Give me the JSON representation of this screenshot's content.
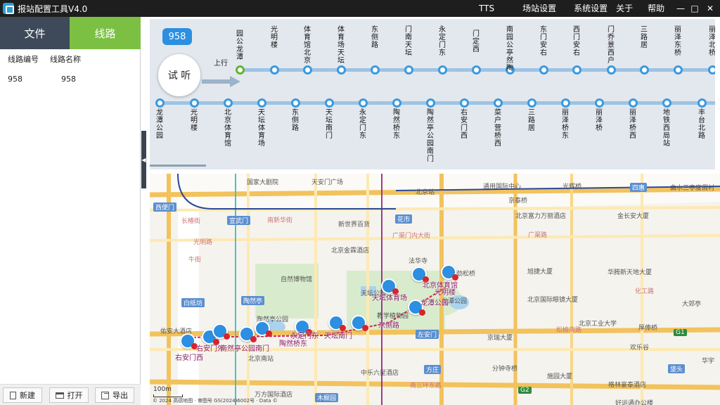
{
  "app": {
    "title": "报站配置工具V4.0"
  },
  "menu": [
    "TTS",
    "场站设置",
    "系统设置",
    "关于",
    "帮助"
  ],
  "window": {
    "minimize": "—",
    "restore": "□",
    "close": "✕"
  },
  "tabs": {
    "file": "文件",
    "route": "线路"
  },
  "table": {
    "headers": [
      "线路编号",
      "线路名称"
    ],
    "rows": [
      [
        "958",
        "958"
      ]
    ]
  },
  "buttons": {
    "new": "新建",
    "open": "打开",
    "export": "导出"
  },
  "route": {
    "number": "958",
    "listen": "试 听",
    "direction_label": "上行",
    "up_stops": [
      "园公龙潭",
      "光明楼",
      "体育馆北京",
      "体育场天坛",
      "东侧路",
      "门南天坛",
      "永定门东",
      "门定西",
      "南园公亭然陶",
      "东门安右",
      "西门安右",
      "门乔景西户",
      "三路居",
      "丽泽东桥",
      "丽泽北桥"
    ],
    "down_stops": [
      "龙潭公园",
      "光明楼",
      "北京体育馆",
      "天坛体育场",
      "东侧路",
      "天坛南门",
      "永定门东",
      "陶然桥东",
      "陶然亭公园南门",
      "右安门西",
      "菜户营桥西",
      "三路居",
      "丽泽桥东",
      "丽泽桥",
      "丽泽桥西",
      "地铁西局站",
      "丰台北路"
    ]
  },
  "map": {
    "labels": [
      {
        "t": "国家大剧院",
        "c": "#555"
      },
      {
        "t": "天安门广场",
        "c": "#555"
      },
      {
        "t": "北京站",
        "c": "#555"
      },
      {
        "t": "通用国际中心",
        "c": "#555"
      },
      {
        "t": "光辉桥",
        "c": "#555"
      },
      {
        "t": "四惠",
        "c": "#fff",
        "bg": "#5b8fd0"
      },
      {
        "t": "曲水三亭度假村",
        "c": "#555"
      },
      {
        "t": "西便门",
        "c": "#fff",
        "bg": "#5b8fd0"
      },
      {
        "t": "京泰桥",
        "c": "#555"
      },
      {
        "t": "北京富力万丽酒店",
        "c": "#555"
      },
      {
        "t": "金长安大厦",
        "c": "#555"
      },
      {
        "t": "宣武门",
        "c": "#fff",
        "bg": "#5b8fd0"
      },
      {
        "t": "新世界百货",
        "c": "#555"
      },
      {
        "t": "花市",
        "c": "#fff",
        "bg": "#5b8fd0"
      },
      {
        "t": "广渠门内大街",
        "c": "#c77"
      },
      {
        "t": "广渠路",
        "c": "#c77"
      },
      {
        "t": "北京金霖酒店",
        "c": "#555"
      },
      {
        "t": "法华寺",
        "c": "#555"
      },
      {
        "t": "劲松桥",
        "c": "#555"
      },
      {
        "t": "旭捷大厦",
        "c": "#555"
      },
      {
        "t": "华腾新天地大厦",
        "c": "#555"
      },
      {
        "t": "自然博物馆",
        "c": "#555"
      },
      {
        "t": "北京国际眼镜大厦",
        "c": "#555"
      },
      {
        "t": "大郊亭",
        "c": "#555"
      },
      {
        "t": "白纸坊",
        "c": "#fff",
        "bg": "#5b8fd0"
      },
      {
        "t": "陶然亭",
        "c": "#fff",
        "bg": "#5b8fd0"
      },
      {
        "t": "陶然亭公园",
        "c": "#555"
      },
      {
        "t": "天坛公园",
        "c": "#555"
      },
      {
        "t": "龙潭公园",
        "c": "#555"
      },
      {
        "t": "北京工业大学",
        "c": "#555"
      },
      {
        "t": "佑安大酒店",
        "c": "#555"
      },
      {
        "t": "教学植物园",
        "c": "#555"
      },
      {
        "t": "厚俸桥",
        "c": "#555"
      },
      {
        "t": "松榆南路",
        "c": "#c77"
      },
      {
        "t": "左安门",
        "c": "#fff",
        "bg": "#5b8fd0"
      },
      {
        "t": "京瑞大厦",
        "c": "#555"
      },
      {
        "t": "欢乐谷",
        "c": "#555"
      },
      {
        "t": "北京南站",
        "c": "#555"
      },
      {
        "t": "中乐六星酒店",
        "c": "#555"
      },
      {
        "t": "方庄",
        "c": "#fff",
        "bg": "#5b8fd0"
      },
      {
        "t": "分钟寺桥",
        "c": "#555"
      },
      {
        "t": "施园大厦",
        "c": "#555"
      },
      {
        "t": "垡头",
        "c": "#fff",
        "bg": "#5b8fd0"
      },
      {
        "t": "华宇",
        "c": "#555"
      },
      {
        "t": "格林豪泰酒店",
        "c": "#555"
      },
      {
        "t": "万方国际酒店",
        "c": "#555"
      },
      {
        "t": "木樨园",
        "c": "#fff",
        "bg": "#5b8fd0"
      },
      {
        "t": "南三环东路",
        "c": "#c77"
      },
      {
        "t": "好运通办公楼",
        "c": "#555"
      },
      {
        "t": "长椿街",
        "c": "#c77"
      },
      {
        "t": "牛街",
        "c": "#c77"
      },
      {
        "t": "南新华街",
        "c": "#c77"
      },
      {
        "t": "光明路",
        "c": "#c77"
      },
      {
        "t": "化工路",
        "c": "#c77"
      },
      {
        "t": "G1",
        "c": "#fff",
        "bg": "#2d8a3e"
      },
      {
        "t": "G2",
        "c": "#fff",
        "bg": "#2d8a3e"
      }
    ],
    "stop_labels": [
      "右安门西",
      "右安门外",
      "南然亭公园南门",
      "陶然桥东",
      "永定门东",
      "天坛南门",
      "东侧路",
      "天坛体育场",
      "北京体育馆",
      "光明楼",
      "龙潭公园"
    ],
    "scale": "100m",
    "copyright": "© 2024 高德地图 · 审图号 GS(2024)6002号 · Data ©"
  },
  "colors": {
    "accent": "#7cc043",
    "stop_ring": "#3a9ae0",
    "first_stop": "#62b52f",
    "badge": "#2c8fe2"
  }
}
